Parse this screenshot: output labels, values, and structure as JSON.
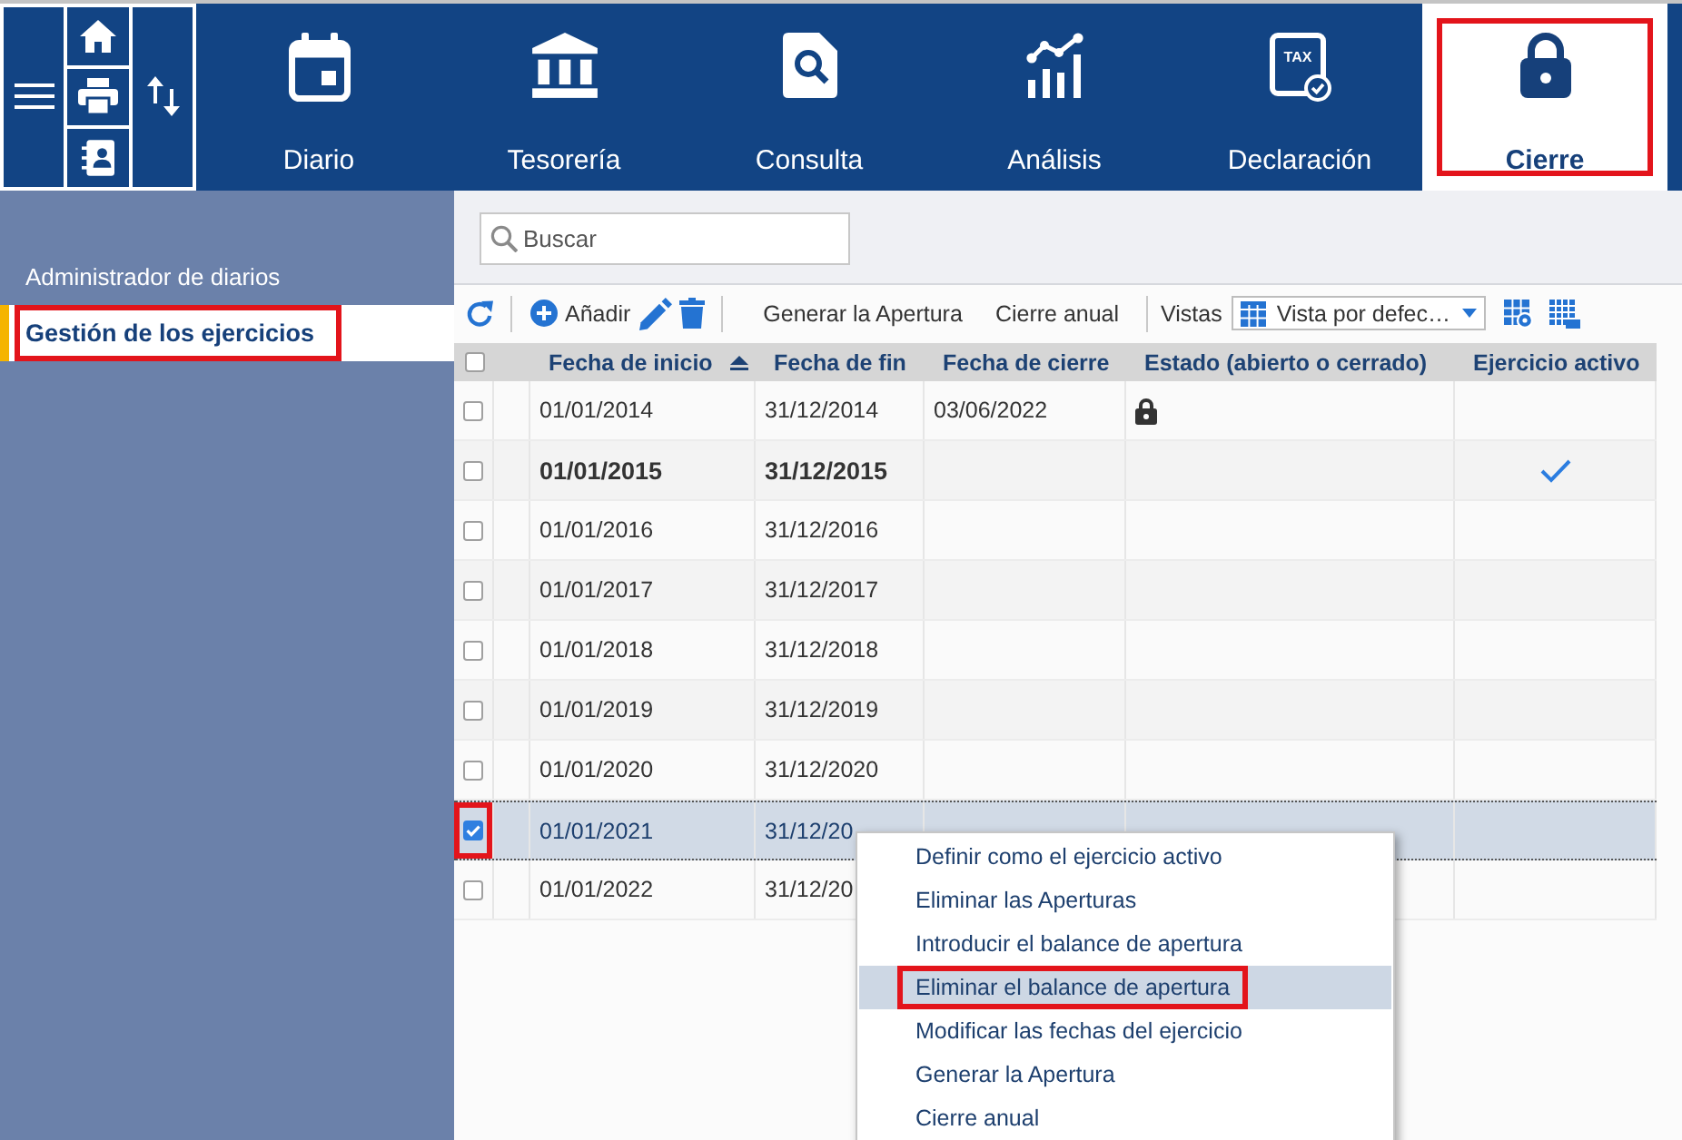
{
  "header": {
    "nav": [
      {
        "label": "Diario",
        "selected": false,
        "highlighted": false
      },
      {
        "label": "Tesorería",
        "selected": false,
        "highlighted": false
      },
      {
        "label": "Consulta",
        "selected": false,
        "highlighted": false
      },
      {
        "label": "Análisis",
        "selected": false,
        "highlighted": false
      },
      {
        "label": "Declaración",
        "icon_text": "TAX",
        "selected": false,
        "highlighted": false
      },
      {
        "label": "Cierre",
        "selected": true,
        "highlighted": true
      }
    ]
  },
  "sidebar": {
    "items": [
      {
        "label": "Administrador de diarios",
        "selected": false,
        "highlighted": false
      },
      {
        "label": "Gestión de los ejercicios",
        "selected": true,
        "highlighted": true
      }
    ]
  },
  "search": {
    "placeholder": "Buscar"
  },
  "toolbar": {
    "add_label": "Añadir",
    "actions": [
      "Generar la Apertura",
      "Cierre anual"
    ],
    "views_label": "Vistas",
    "view_select": {
      "value": "Vista por defec…"
    }
  },
  "table": {
    "select_all": {
      "checked": false
    },
    "columns": [
      {
        "label": "Fecha de inicio",
        "sorted": true
      },
      {
        "label": "Fecha de fin",
        "sorted": false
      },
      {
        "label": "Fecha de cierre",
        "sorted": false
      },
      {
        "label": "Estado (abierto o cerrado)",
        "sorted": false
      },
      {
        "label": "Ejercicio activo",
        "sorted": false
      }
    ],
    "rows": [
      {
        "selected": false,
        "highlighted": false,
        "active": false,
        "closed": true,
        "start_date": "01/01/2014",
        "end_date": "31/12/2014",
        "closing_date": "03/06/2022"
      },
      {
        "selected": false,
        "highlighted": false,
        "active": true,
        "closed": false,
        "start_date": "01/01/2015",
        "end_date": "31/12/2015"
      },
      {
        "selected": false,
        "highlighted": false,
        "active": false,
        "closed": false,
        "start_date": "01/01/2016",
        "end_date": "31/12/2016"
      },
      {
        "selected": false,
        "highlighted": false,
        "active": false,
        "closed": false,
        "start_date": "01/01/2017",
        "end_date": "31/12/2017"
      },
      {
        "selected": false,
        "highlighted": false,
        "active": false,
        "closed": false,
        "start_date": "01/01/2018",
        "end_date": "31/12/2018"
      },
      {
        "selected": false,
        "highlighted": false,
        "active": false,
        "closed": false,
        "start_date": "01/01/2019",
        "end_date": "31/12/2019"
      },
      {
        "selected": false,
        "highlighted": false,
        "active": false,
        "closed": false,
        "start_date": "01/01/2020",
        "end_date": "31/12/2020"
      },
      {
        "selected": true,
        "highlighted": true,
        "active": false,
        "closed": false,
        "start_date": "01/01/2021",
        "end_date": "31/12/20"
      },
      {
        "selected": false,
        "highlighted": false,
        "active": false,
        "closed": false,
        "start_date": "01/01/2022",
        "end_date": "31/12/20"
      }
    ]
  },
  "context_menu": {
    "items": [
      {
        "label": "Definir como el ejercicio activo",
        "selected": false,
        "highlighted": false
      },
      {
        "label": "Eliminar las Aperturas",
        "selected": false,
        "highlighted": false
      },
      {
        "label": "Introducir el balance de apertura",
        "selected": false,
        "highlighted": false
      },
      {
        "label": "Eliminar el balance de apertura",
        "selected": true,
        "highlighted": true
      },
      {
        "label": "Modificar las fechas del ejercicio",
        "selected": false,
        "highlighted": false
      },
      {
        "label": "Generar la Apertura",
        "selected": false,
        "highlighted": false
      },
      {
        "label": "Cierre anual",
        "selected": false,
        "highlighted": false
      }
    ]
  }
}
